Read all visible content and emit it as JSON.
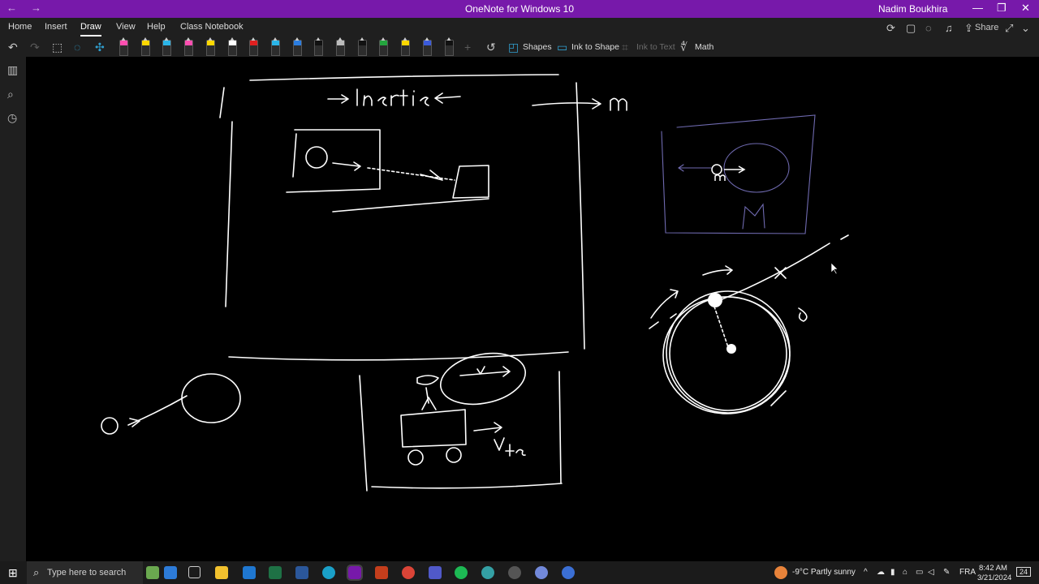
{
  "window": {
    "title": "OneNote for Windows 10",
    "user": "Nadim Boukhira",
    "back_glyph": "←",
    "forward_glyph": "→",
    "min_glyph": "—",
    "max_glyph": "❐",
    "close_glyph": "✕"
  },
  "ribbon": {
    "tabs": [
      "Home",
      "Insert",
      "Draw",
      "View",
      "Help",
      "Class Notebook"
    ],
    "active_tab": "Draw",
    "share_label": "Share"
  },
  "draw_tools": {
    "shapes_label": "Shapes",
    "ink_to_shape_label": "Ink to Shape",
    "ink_to_text_label": "Ink to Text",
    "math_label": "Math",
    "pen_colors": [
      "#ff4fb0",
      "#ffd800",
      "#2bb5e8",
      "#ff4fb0",
      "#ffd800",
      "#ffffff",
      "#e02020",
      "#2bb5e8",
      "#2b7de0",
      "#111111",
      "#bbbbbb",
      "#111111",
      "#24a53e",
      "#ffd800",
      "#3b5bdb",
      "#111111"
    ]
  },
  "taskbar": {
    "search_placeholder": "Type here to search",
    "weather": "-9°C  Partly sunny",
    "language": "FRA",
    "time": "8:42 AM",
    "date": "3/21/2024",
    "notifications": "24"
  },
  "colors": {
    "accent": "#7719aa",
    "ink": "#ffffff",
    "ink_faint": "#6f6ab0"
  }
}
